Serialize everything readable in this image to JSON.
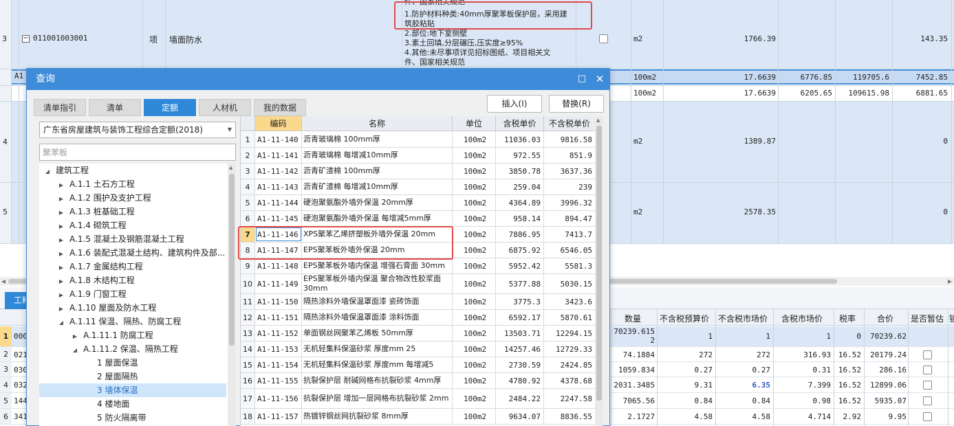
{
  "top_rows": [
    {
      "row_no": "3",
      "code": "011001003001",
      "type": "项",
      "name": "墙面防水",
      "desc_top": "件、国家相关规范",
      "desc": [
        "1.防护材料种类:40mm厚聚苯板保护层，采用建",
        "筑胶粘贴",
        "2.部位:地下室侧壁",
        "3.素土回填,分层碾压,压实度≥95%",
        "4.其他:未尽事项详见招标图纸、项目相关文",
        "件、国家相关规范"
      ],
      "unit": "m2",
      "qty": "1766.39",
      "amount": "143.35"
    }
  ],
  "sub_rows": [
    {
      "code": "A1",
      "unit": "100m2",
      "qty": "17.6639",
      "price": "6776.85",
      "total": "119705.6",
      "last": "7452.85"
    },
    {
      "unit": "100m2",
      "qty": "17.6639",
      "price": "6205.65",
      "total": "109615.98",
      "last": "6881.65"
    }
  ],
  "lower_rows": [
    {
      "row_no": "4",
      "unit": "m2",
      "qty": "1389.87",
      "last": "0"
    },
    {
      "row_no": "5",
      "unit": "m2",
      "qty": "2578.35",
      "last": "0"
    }
  ],
  "bottom_panel": {
    "tab": "工料",
    "headers": [
      "数量",
      "不含税预算价",
      "不含税市场价",
      "含税市场价",
      "税率",
      "合价",
      "是否暂估",
      "锁"
    ],
    "rows": [
      {
        "no": "1",
        "code": "000",
        "qty": "70239.615\n2",
        "budget": "1",
        "market": "1",
        "market_tax": "1",
        "rate": "0",
        "total": "70239.62",
        "estimate": false
      },
      {
        "no": "2",
        "code": "021",
        "qty": "74.1884",
        "budget": "272",
        "market": "272",
        "market_tax": "316.93",
        "rate": "16.52",
        "total": "20179.24",
        "estimate": true
      },
      {
        "no": "3",
        "code": "030",
        "qty": "1059.834",
        "budget": "0.27",
        "market": "0.27",
        "market_tax": "0.31",
        "rate": "16.52",
        "total": "286.16",
        "estimate": true
      },
      {
        "no": "4",
        "code": "032",
        "qty": "2031.3485",
        "budget": "9.31",
        "market": "6.35",
        "market_tax": "7.399",
        "rate": "16.52",
        "total": "12899.06",
        "estimate": true
      },
      {
        "no": "5",
        "code": "144",
        "qty": "7065.56",
        "budget": "0.84",
        "market": "0.84",
        "market_tax": "0.98",
        "rate": "16.52",
        "total": "5935.07",
        "estimate": true
      },
      {
        "no": "6",
        "code": "341",
        "qty": "2.1727",
        "budget": "4.58",
        "market": "4.58",
        "market_tax": "4.714",
        "rate": "2.92",
        "total": "9.95",
        "estimate": true
      }
    ]
  },
  "dialog": {
    "title": "查询",
    "tabs": [
      "清单指引",
      "清单",
      "定额",
      "人材机",
      "我的数据"
    ],
    "active_tab": "定额",
    "insert_button": "插入(I)",
    "replace_button": "替换(R)",
    "quota_library": "广东省房屋建筑与装饰工程综合定额(2018)",
    "search_value": "",
    "search_placeholder": "聚苯板",
    "tree": [
      {
        "label": "建筑工程",
        "level": 0,
        "arrow": "open"
      },
      {
        "label": "A.1.1 土石方工程",
        "level": 1,
        "arrow": "closed"
      },
      {
        "label": "A.1.2 围护及支护工程",
        "level": 1,
        "arrow": "closed"
      },
      {
        "label": "A.1.3 桩基础工程",
        "level": 1,
        "arrow": "closed"
      },
      {
        "label": "A.1.4 砌筑工程",
        "level": 1,
        "arrow": "closed"
      },
      {
        "label": "A.1.5 混凝土及钢筋混凝土工程",
        "level": 1,
        "arrow": "closed"
      },
      {
        "label": "A.1.6 装配式混凝土结构、建筑构件及部...",
        "level": 1,
        "arrow": "closed"
      },
      {
        "label": "A.1.7 金属结构工程",
        "level": 1,
        "arrow": "closed"
      },
      {
        "label": "A.1.8 木结构工程",
        "level": 1,
        "arrow": "closed"
      },
      {
        "label": "A.1.9 门窗工程",
        "level": 1,
        "arrow": "closed"
      },
      {
        "label": "A.1.10 屋面及防水工程",
        "level": 1,
        "arrow": "closed"
      },
      {
        "label": "A.1.11 保温、隔热、防腐工程",
        "level": 1,
        "arrow": "open"
      },
      {
        "label": "A.1.11.1 防腐工程",
        "level": 2,
        "arrow": "closed"
      },
      {
        "label": "A.1.11.2 保温、隔热工程",
        "level": 2,
        "arrow": "open"
      },
      {
        "label": "1 屋面保温",
        "level": 3,
        "arrow": ""
      },
      {
        "label": "2 屋面隔热",
        "level": 3,
        "arrow": ""
      },
      {
        "label": "3 墙体保温",
        "level": 3,
        "arrow": "",
        "selected": true
      },
      {
        "label": "4 楼地面",
        "level": 3,
        "arrow": ""
      },
      {
        "label": "5 防火隔离带",
        "level": 3,
        "arrow": ""
      }
    ],
    "grid_headers": [
      "",
      "编码",
      "名称",
      "单位",
      "含税单价",
      "不含税单价"
    ],
    "grid_rows": [
      {
        "no": "1",
        "code": "A1-11-140",
        "name": "沥青玻璃棉 100mm厚",
        "unit": "100m2",
        "price_tax": "11036.03",
        "price": "9816.58"
      },
      {
        "no": "2",
        "code": "A1-11-141",
        "name": "沥青玻璃棉 每增减10mm厚",
        "unit": "100m2",
        "price_tax": "972.55",
        "price": "851.9"
      },
      {
        "no": "3",
        "code": "A1-11-142",
        "name": "沥青矿渣棉 100mm厚",
        "unit": "100m2",
        "price_tax": "3850.78",
        "price": "3637.36"
      },
      {
        "no": "4",
        "code": "A1-11-143",
        "name": "沥青矿渣棉 每增减10mm厚",
        "unit": "100m2",
        "price_tax": "259.04",
        "price": "239"
      },
      {
        "no": "5",
        "code": "A1-11-144",
        "name": "硬泡聚氨酯外墙外保温 20mm厚",
        "unit": "100m2",
        "price_tax": "4364.89",
        "price": "3996.32"
      },
      {
        "no": "6",
        "code": "A1-11-145",
        "name": "硬泡聚氨酯外墙外保温 每增减5mm厚",
        "unit": "100m2",
        "price_tax": "958.14",
        "price": "894.47"
      },
      {
        "no": "7",
        "code": "A1-11-146",
        "name": "XPS聚苯乙烯挤塑板外墙外保温 20mm",
        "unit": "100m2",
        "price_tax": "7886.95",
        "price": "7413.7",
        "highlight": true
      },
      {
        "no": "8",
        "code": "A1-11-147",
        "name": "EPS聚苯板外墙外保温 20mm",
        "unit": "100m2",
        "price_tax": "6875.92",
        "price": "6546.05"
      },
      {
        "no": "9",
        "code": "A1-11-148",
        "name": "EPS聚苯板外墙内保温 增强石膏面 30mm",
        "unit": "100m2",
        "price_tax": "5952.42",
        "price": "5581.3"
      },
      {
        "no": "10",
        "code": "A1-11-149",
        "name": "EPS聚苯板外墙内保温 聚合物改性胶浆面 30mm",
        "unit": "100m2",
        "price_tax": "5377.88",
        "price": "5030.15",
        "tall": true
      },
      {
        "no": "11",
        "code": "A1-11-150",
        "name": "隔热涂料外墙保温罩面漆 瓷砖饰面",
        "unit": "100m2",
        "price_tax": "3775.3",
        "price": "3423.6"
      },
      {
        "no": "12",
        "code": "A1-11-151",
        "name": "隔热涂料外墙保温罩面漆 涂料饰面",
        "unit": "100m2",
        "price_tax": "6592.17",
        "price": "5870.61"
      },
      {
        "no": "13",
        "code": "A1-11-152",
        "name": "单面钢丝网聚苯乙烯板 50mm厚",
        "unit": "100m2",
        "price_tax": "13503.71",
        "price": "12294.15"
      },
      {
        "no": "14",
        "code": "A1-11-153",
        "name": "无机轻集料保温砂浆 厚度mm 25",
        "unit": "100m2",
        "price_tax": "14257.46",
        "price": "12729.33"
      },
      {
        "no": "15",
        "code": "A1-11-154",
        "name": "无机轻集料保温砂浆 厚度mm 每增减5",
        "unit": "100m2",
        "price_tax": "2730.59",
        "price": "2424.85"
      },
      {
        "no": "16",
        "code": "A1-11-155",
        "name": "抗裂保护层 耐碱网格布抗裂砂浆 4mm厚",
        "unit": "100m2",
        "price_tax": "4780.92",
        "price": "4378.68"
      },
      {
        "no": "17",
        "code": "A1-11-156",
        "name": "抗裂保护层 增加一层网格布抗裂砂浆 2mm",
        "unit": "100m2",
        "price_tax": "2484.22",
        "price": "2247.58",
        "tall": true
      },
      {
        "no": "18",
        "code": "A1-11-157",
        "name": "热镀锌钢丝网抗裂砂浆 8mm厚",
        "unit": "100m2",
        "price_tax": "9634.07",
        "price": "8836.55"
      }
    ]
  }
}
